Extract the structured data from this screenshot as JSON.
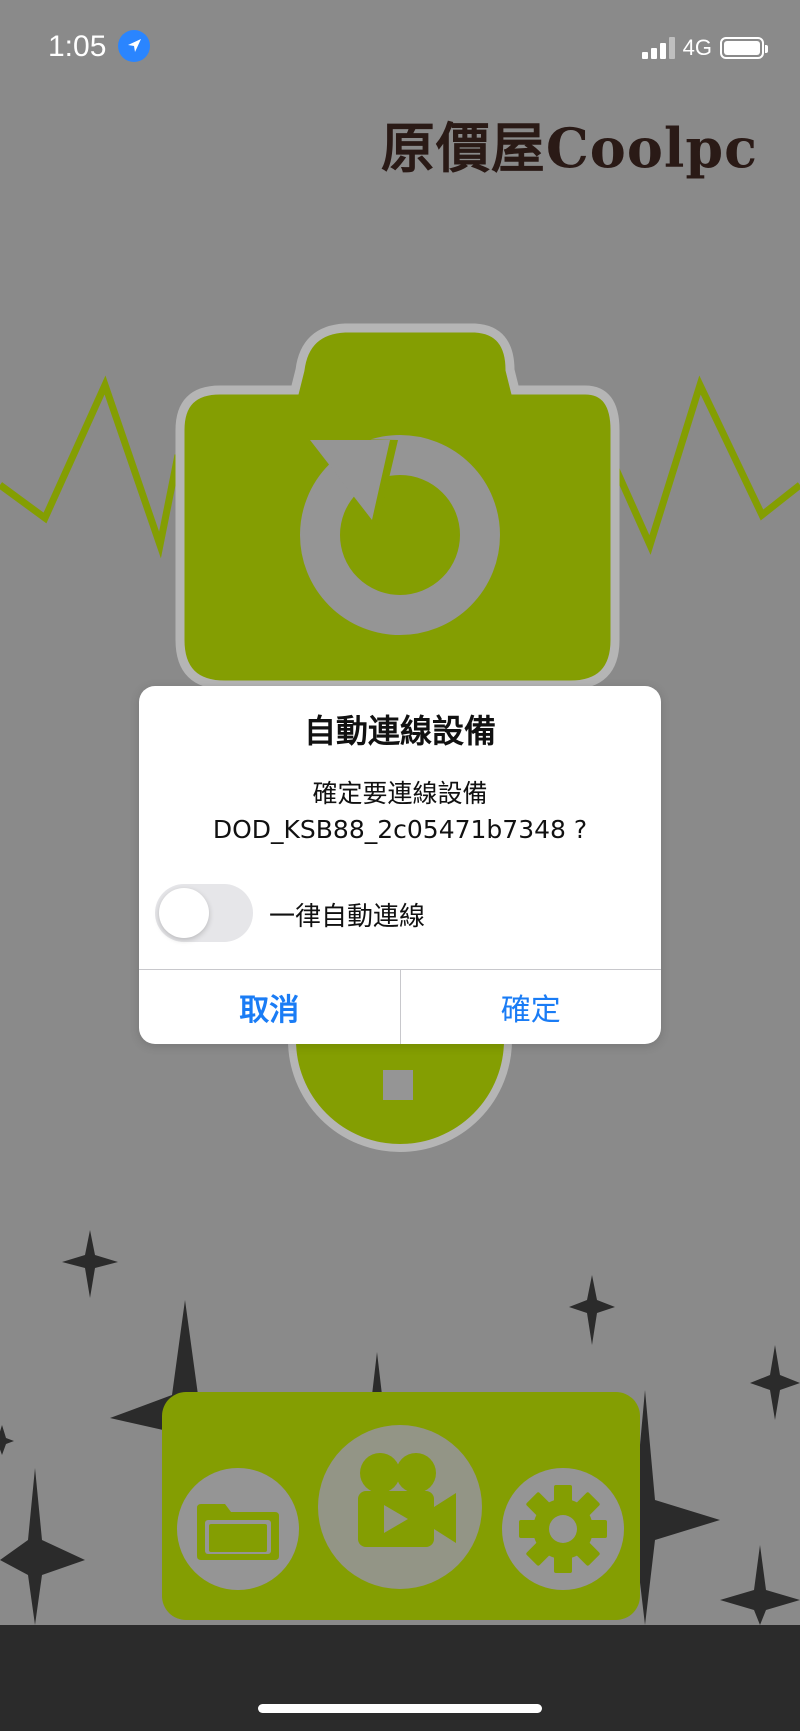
{
  "status_bar": {
    "time": "1:05",
    "network": "4G",
    "signal_bars": 3,
    "battery_level": 1.0,
    "icons": [
      "location-arrow-icon",
      "signal-icon",
      "battery-icon"
    ]
  },
  "logo": {
    "text": "原價屋Coolpc"
  },
  "colors": {
    "background": "#8a8a8a",
    "accent_green": "#849e02",
    "dialog_button": "#1a7cf5",
    "dark_bar": "#2b2b2b"
  },
  "main_icons": [
    "camera-refresh-icon",
    "help-icon",
    "folder-icon",
    "video-camera-icon",
    "settings-icon"
  ],
  "dialog": {
    "title": "自動連線設備",
    "message_line1": "確定要連線設備",
    "message_line2": "DOD_KSB88_2c05471b7348 ?",
    "toggle_label": "一律自動連線",
    "toggle_on": false,
    "cancel": "取消",
    "confirm": "確定"
  }
}
